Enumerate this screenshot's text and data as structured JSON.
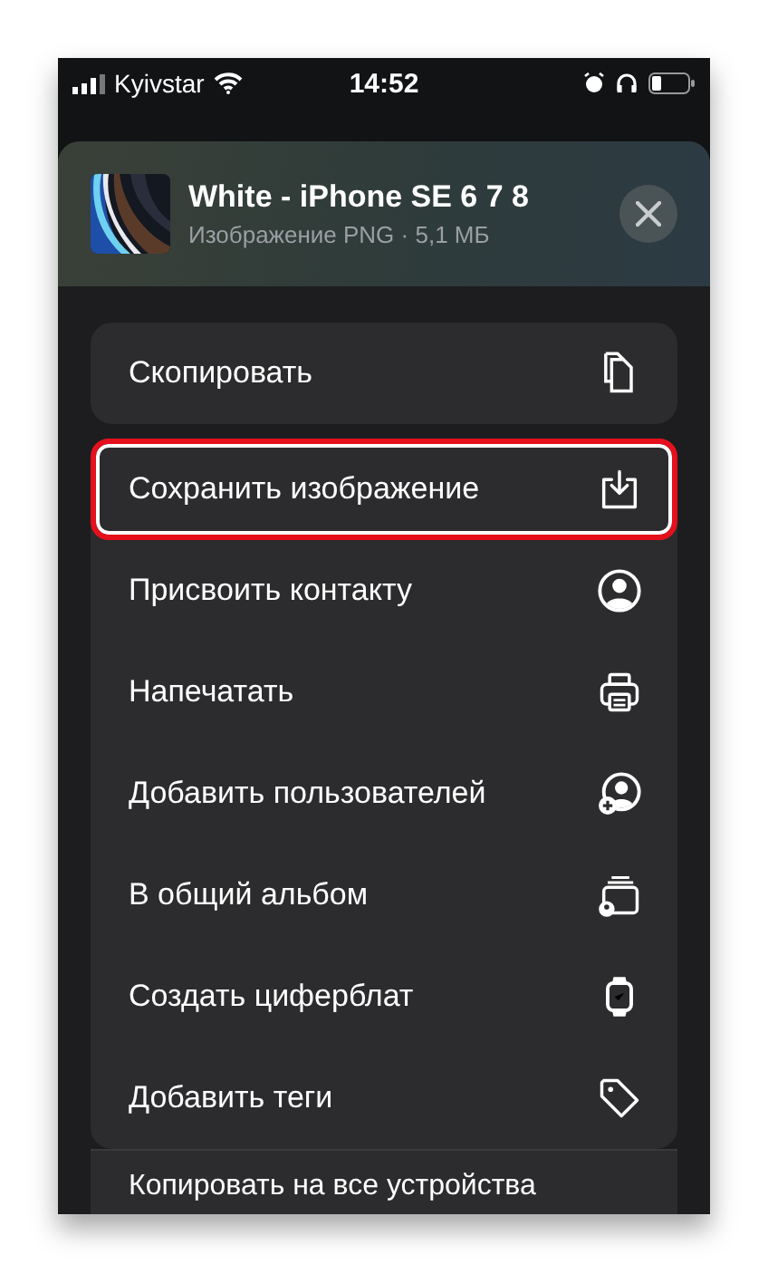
{
  "status_bar": {
    "carrier": "Kyivstar",
    "time": "14:52"
  },
  "share_sheet": {
    "title": "White - iPhone SE 6 7 8",
    "subtitle": "Изображение PNG · 5,1 МБ",
    "groups": [
      {
        "items": [
          {
            "label": "Скопировать",
            "highlighted": false
          }
        ]
      },
      {
        "items": [
          {
            "label": "Сохранить изображение",
            "highlighted": true
          },
          {
            "label": "Присвоить контакту",
            "highlighted": false
          },
          {
            "label": "Напечатать",
            "highlighted": false
          },
          {
            "label": "Добавить пользователей",
            "highlighted": false
          },
          {
            "label": "В общий альбом",
            "highlighted": false
          },
          {
            "label": "Создать циферблат",
            "highlighted": false
          },
          {
            "label": "Добавить теги",
            "highlighted": false
          }
        ]
      },
      {
        "items": [
          {
            "label": "Копировать на все устройства",
            "highlighted": false
          }
        ]
      }
    ]
  }
}
